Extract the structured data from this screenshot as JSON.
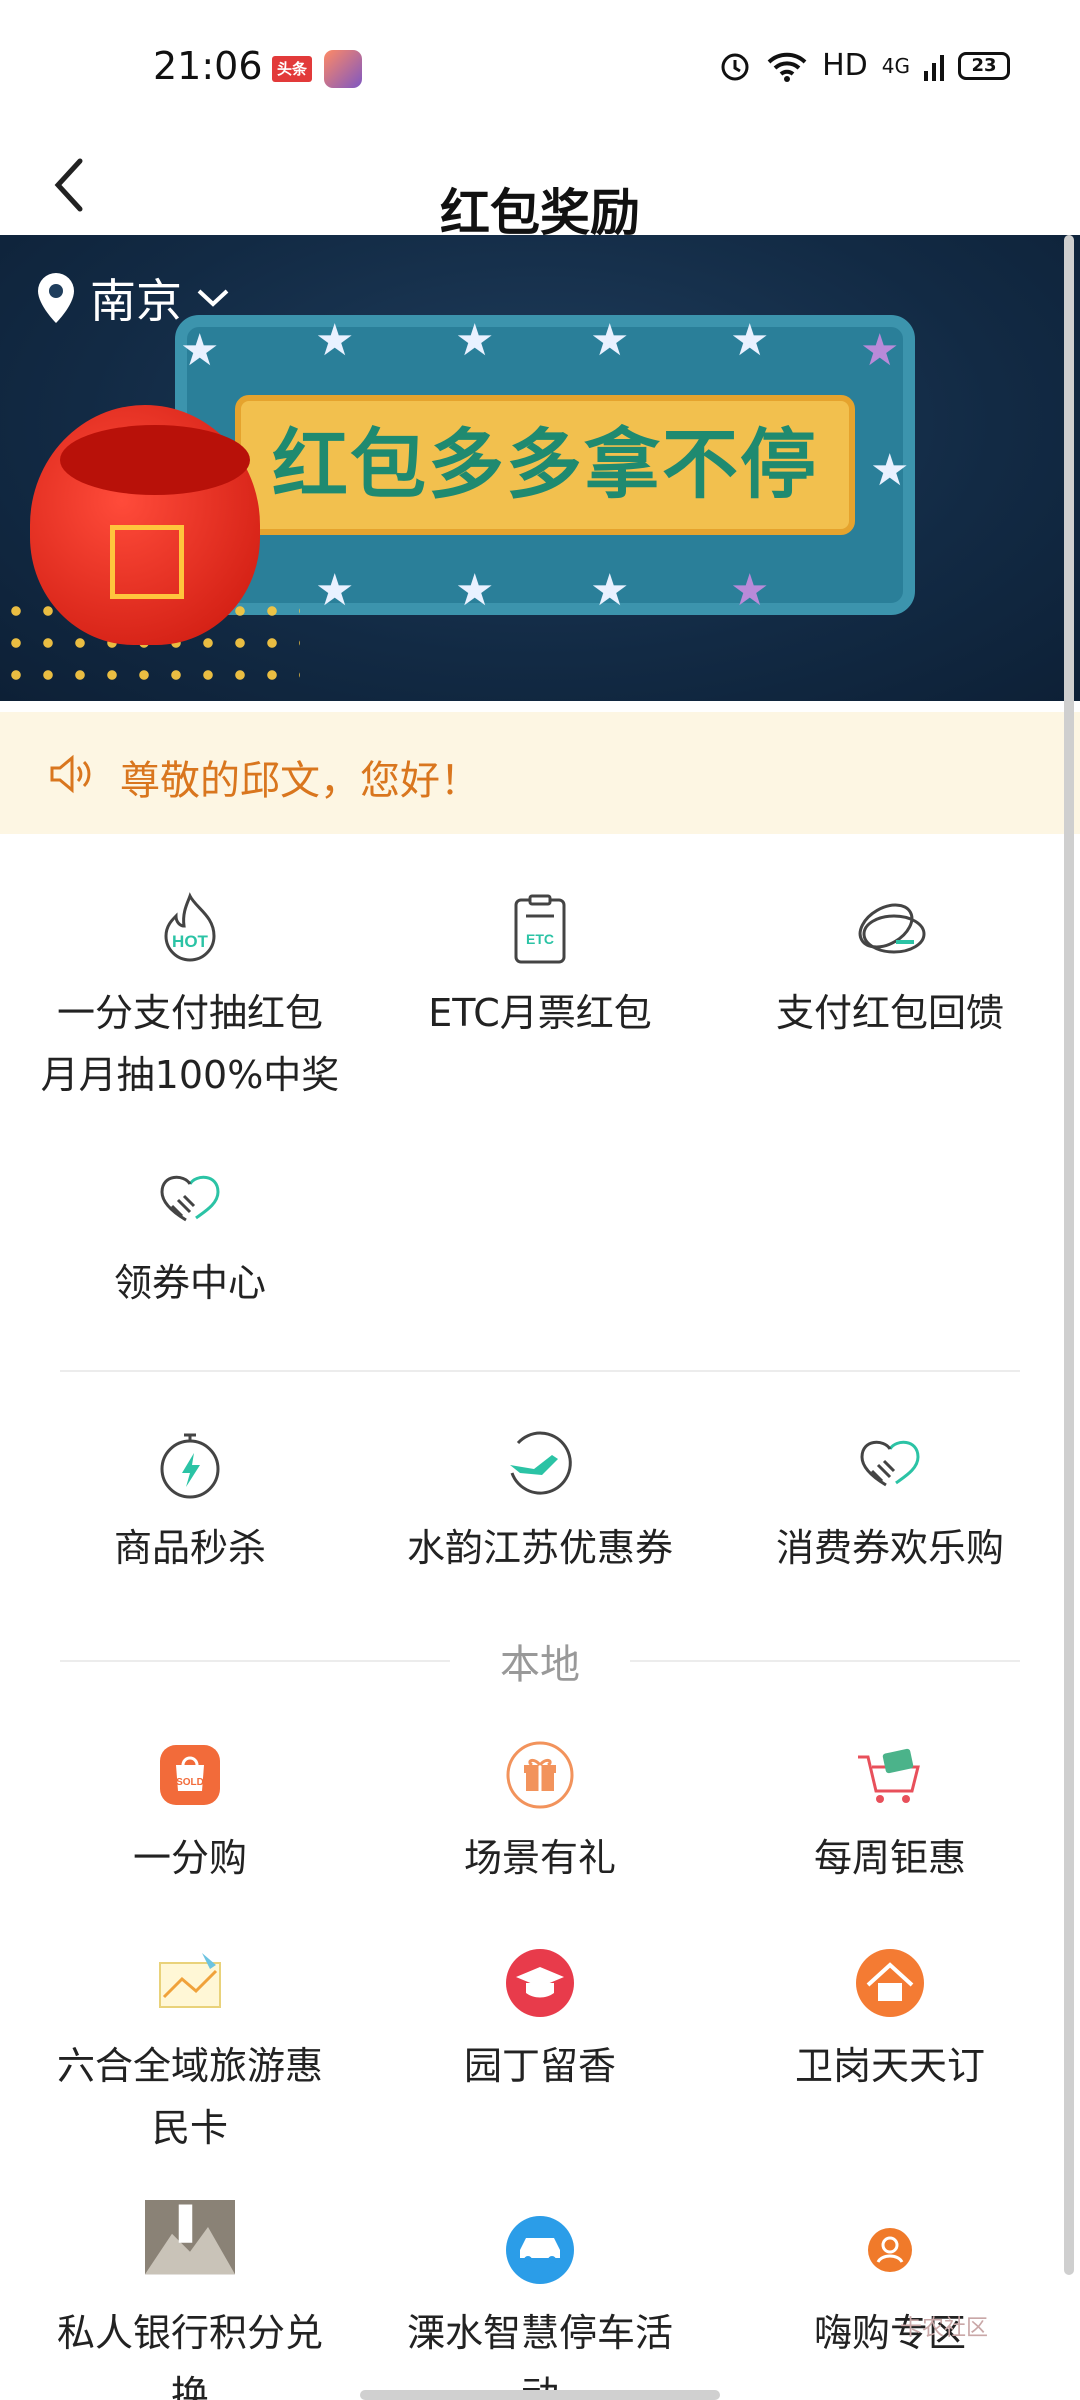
{
  "status_bar": {
    "time": "21:06",
    "news_badge": "头条",
    "network": "HD",
    "signal": "4G",
    "battery": "23"
  },
  "header": {
    "title": "红包奖励",
    "back_icon": "back-chevron-icon"
  },
  "banner": {
    "city": "南京",
    "headline": "红包多多拿不停"
  },
  "notice": {
    "text": "尊敬的邱文，您好！",
    "icon": "speaker-icon"
  },
  "section1": [
    {
      "line1": "一分支付抽红包",
      "line2": "月月抽100%中奖",
      "icon": "hot-flame-icon"
    },
    {
      "line1": "ETC月票红包",
      "line2": "",
      "icon": "etc-card-icon"
    },
    {
      "line1": "支付红包回馈",
      "line2": "",
      "icon": "coupon-disc-icon"
    },
    {
      "line1": "领券中心",
      "line2": "",
      "icon": "handshake-heart-icon"
    }
  ],
  "section2": [
    {
      "label": "商品秒杀",
      "icon": "stopwatch-bolt-icon"
    },
    {
      "label": "水韵江苏优惠券",
      "icon": "plane-globe-icon"
    },
    {
      "label": "消费券欢乐购",
      "icon": "handshake-heart-icon"
    }
  ],
  "local": {
    "title": "本地",
    "items": [
      {
        "line1": "一分购",
        "line2": "",
        "icon": "sold-bag-icon"
      },
      {
        "line1": "场景有礼",
        "line2": "",
        "icon": "gift-icon"
      },
      {
        "line1": "每周钜惠",
        "line2": "",
        "icon": "shopping-cart-icon"
      },
      {
        "line1": "六合全域旅游惠",
        "line2": "民卡",
        "icon": "travel-map-icon"
      },
      {
        "line1": "园丁留香",
        "line2": "",
        "icon": "graduation-cap-icon"
      },
      {
        "line1": "卫岗天天订",
        "line2": "",
        "icon": "house-icon"
      },
      {
        "line1": "私人银行积分兑",
        "line2": "换",
        "icon": "private-bank-logo-icon"
      },
      {
        "line1": "溧水智慧停车活",
        "line2": "动",
        "icon": "car-icon"
      },
      {
        "line1": "嗨购专区",
        "line2": "",
        "icon": "user-badge-icon"
      }
    ]
  },
  "watermark": "卡农社区",
  "colors": {
    "accent_orange": "#d9761e",
    "teal": "#2bc3a5",
    "notice_bg": "#fdf6e3"
  }
}
